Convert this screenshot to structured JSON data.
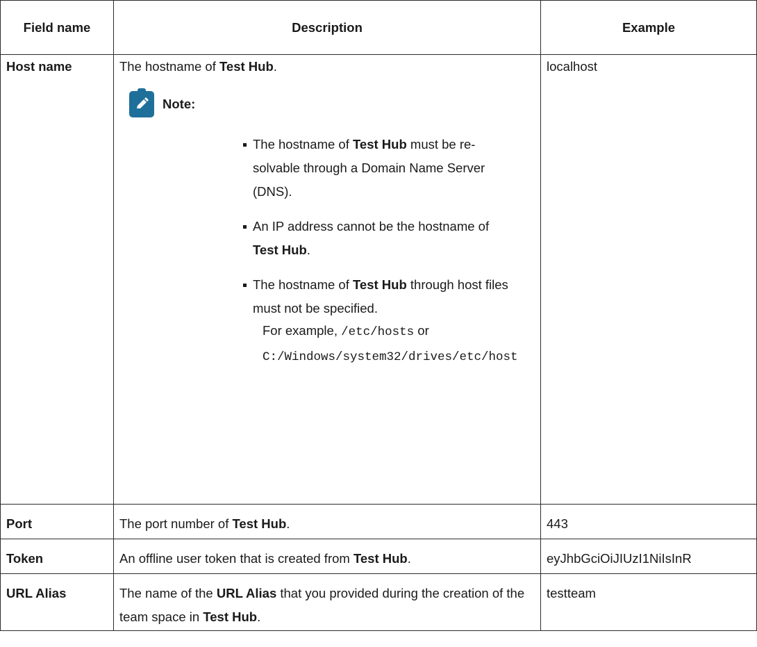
{
  "header": {
    "field_name": "Field name",
    "description": "Description",
    "example": "Example"
  },
  "rows": {
    "host": {
      "field": "Host name",
      "desc_pre": "The hostname of ",
      "desc_bold": "Test Hub",
      "desc_post": ".",
      "example": "localhost",
      "note_label": "Note:",
      "note_icon": "pencil-note-icon",
      "note_items": [
        {
          "pre": "The hostname of ",
          "bold": "Test Hub",
          "post": " must be re-solvable through a Domain Name Server (DNS)."
        },
        {
          "pre": "An IP address cannot be the hostname of ",
          "bold": "Test Hub",
          "post": "."
        },
        {
          "pre": "The hostname of ",
          "bold": "Test Hub",
          "post": " through host files must not be specified."
        }
      ],
      "for_example_label": "For example, ",
      "code1": "/etc/hosts",
      "or_text": " or ",
      "code2": "C:/Windows/system32/drives/etc/host"
    },
    "port": {
      "field": "Port",
      "desc_pre": "The port number of ",
      "desc_bold": "Test Hub",
      "desc_post": ".",
      "example": "443"
    },
    "token": {
      "field": "Token",
      "desc_pre": "An offline user token that is created from ",
      "desc_bold": "Test Hub",
      "desc_post": ".",
      "example": "eyJhbGciOiJIUzI1NiIsInR"
    },
    "url_alias": {
      "field": "URL Alias",
      "desc_pre": "The name of the ",
      "desc_bold1": "URL Alias",
      "desc_mid": " that you provided during the creation of the team space in ",
      "desc_bold2": "Test Hub",
      "desc_post": ".",
      "example": "testteam"
    }
  },
  "colors": {
    "note_icon_bg": "#1f6f9b",
    "border": "#2b2b2b"
  }
}
